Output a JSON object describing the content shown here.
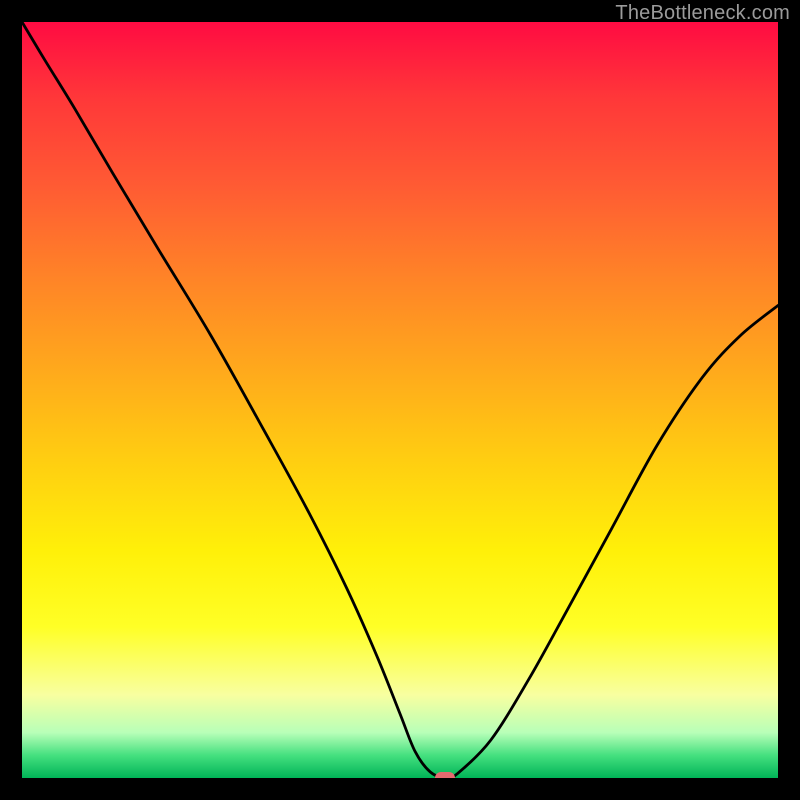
{
  "watermark": "TheBottleneck.com",
  "colors": {
    "background_black": "#000000",
    "curve_stroke": "#000000",
    "marker_fill": "#e36a6f",
    "watermark_text": "#9b9b9b",
    "gradient_top": "#ff0b42",
    "gradient_bottom": "#00b457"
  },
  "chart_data": {
    "type": "line",
    "title": "",
    "xlabel": "",
    "ylabel": "",
    "xlim": [
      0,
      100
    ],
    "ylim": [
      0,
      100
    ],
    "x": [
      0,
      3,
      7,
      12,
      18,
      25,
      32,
      38,
      43,
      47,
      50,
      52,
      54,
      56,
      57.5,
      62,
      67,
      72,
      78,
      84,
      90,
      95,
      100
    ],
    "values": [
      100,
      95,
      88.5,
      80,
      70,
      58.5,
      46,
      35,
      25,
      16,
      8.5,
      3.5,
      0.8,
      0,
      0.5,
      5,
      13,
      22,
      33,
      44,
      53,
      58.5,
      62.5
    ],
    "marker": {
      "x": 56,
      "y": 0
    },
    "grid": false,
    "legend": false
  }
}
